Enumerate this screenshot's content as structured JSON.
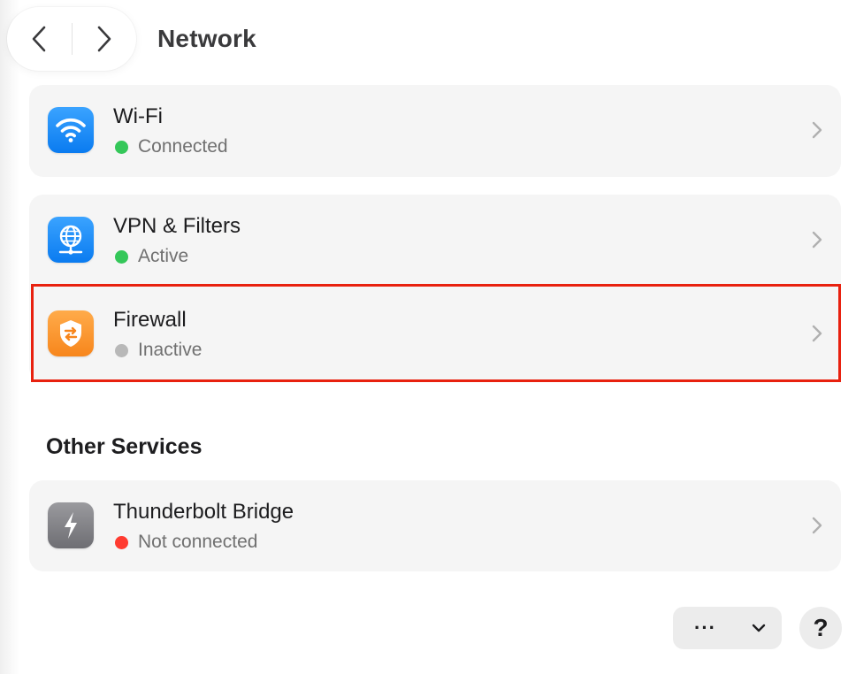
{
  "window": {
    "title": "Network"
  },
  "colors": {
    "status_connected": "#34c759",
    "status_active": "#34c759",
    "status_inactive": "#b8b8b8",
    "status_not_connected": "#ff3b30",
    "highlight": "#e8210f"
  },
  "services": [
    {
      "icon": "wifi-icon",
      "name": "Wi-Fi",
      "status": "Connected"
    },
    {
      "icon": "vpn-globe-icon",
      "name": "VPN & Filters",
      "status": "Active"
    },
    {
      "icon": "firewall-shield-icon",
      "name": "Firewall",
      "status": "Inactive"
    }
  ],
  "other_services": {
    "heading": "Other Services",
    "items": [
      {
        "icon": "thunderbolt-icon",
        "name": "Thunderbolt Bridge",
        "status": "Not connected"
      }
    ]
  },
  "toolbar": {
    "more_label": "···",
    "help_label": "?"
  }
}
